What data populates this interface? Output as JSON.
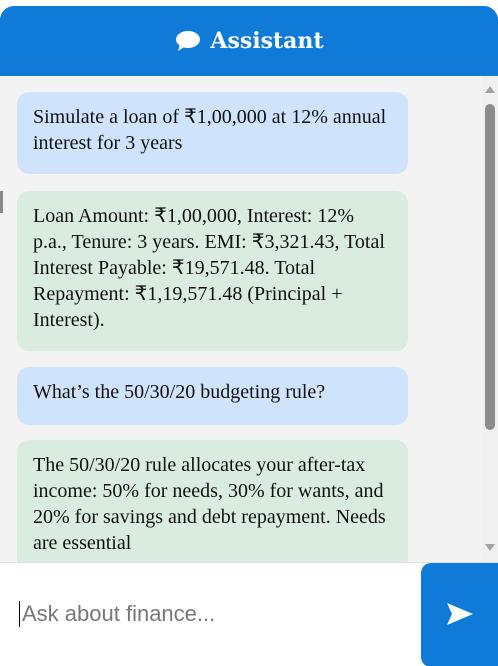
{
  "header": {
    "title": "Assistant",
    "icon": "chat-bubble-icon"
  },
  "messages": [
    {
      "role": "user",
      "text": "Simulate a loan of ₹1,00,000 at 12% annual interest for 3 years"
    },
    {
      "role": "assistant",
      "text": "Loan Amount: ₹1,00,000, Interest: 12% p.a., Tenure: 3 years. EMI: ₹3,321.43, Total Interest Payable: ₹19,571.48. Total Repayment: ₹1,19,571.48 (Principal + Interest)."
    },
    {
      "role": "user",
      "text": "What’s the 50/30/20 budgeting rule?"
    },
    {
      "role": "assistant",
      "text": "The 50/30/20 rule allocates your after-tax income: 50% for needs, 30% for wants, and 20% for savings and debt repayment. Needs are essential"
    }
  ],
  "input": {
    "placeholder": "Ask about finance...",
    "value": ""
  },
  "send_button": {
    "icon": "send-arrow-icon"
  },
  "colors": {
    "accent": "#0f7ad8",
    "user_bubble": "#cfe4fc",
    "assistant_bubble": "#d9ecdf"
  }
}
